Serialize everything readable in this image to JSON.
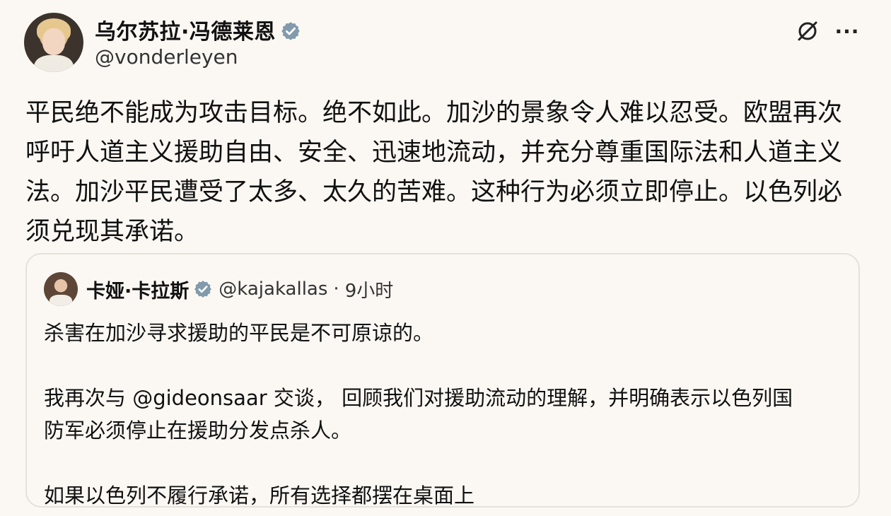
{
  "post": {
    "author_name": "乌尔苏拉·冯德莱恩",
    "author_handle": "@vonderleyen",
    "body_lines": [
      "平民绝不能成为攻击目标。绝不如此。加沙的景象令人难以忍受。欧盟再次",
      "呼吁人道主义援助自由、安全、迅速地流动，并充分尊重国际法和人道主义",
      "法。加沙平民遭受了太多、太久的苦难。这种行为必须立即停止。以色列必",
      "须兑现其承诺。"
    ]
  },
  "quote": {
    "author_name": "卡娅·卡拉斯",
    "author_handle": "@kajakallas",
    "separator": "·",
    "time": "9小时",
    "paragraph1": "杀害在加沙寻求援助的平民是不可原谅的。",
    "paragraph2_lines": [
      "我再次与 @gideonsaar 交谈， 回顾我们对援助流动的理解，并明确表示以色列国",
      "防军必须停止在援助分发点杀人。"
    ],
    "paragraph3": "如果以色列不履行承诺，所有选择都摆在桌面上"
  },
  "toolbar": {
    "more_label": "···"
  },
  "icons": {
    "verified": "verified-badge-icon",
    "grok": "grok-icon",
    "more": "more-options-icon"
  },
  "colors": {
    "background": "#fbf8f3",
    "verified_badge": "#829aab",
    "text": "#111111"
  }
}
